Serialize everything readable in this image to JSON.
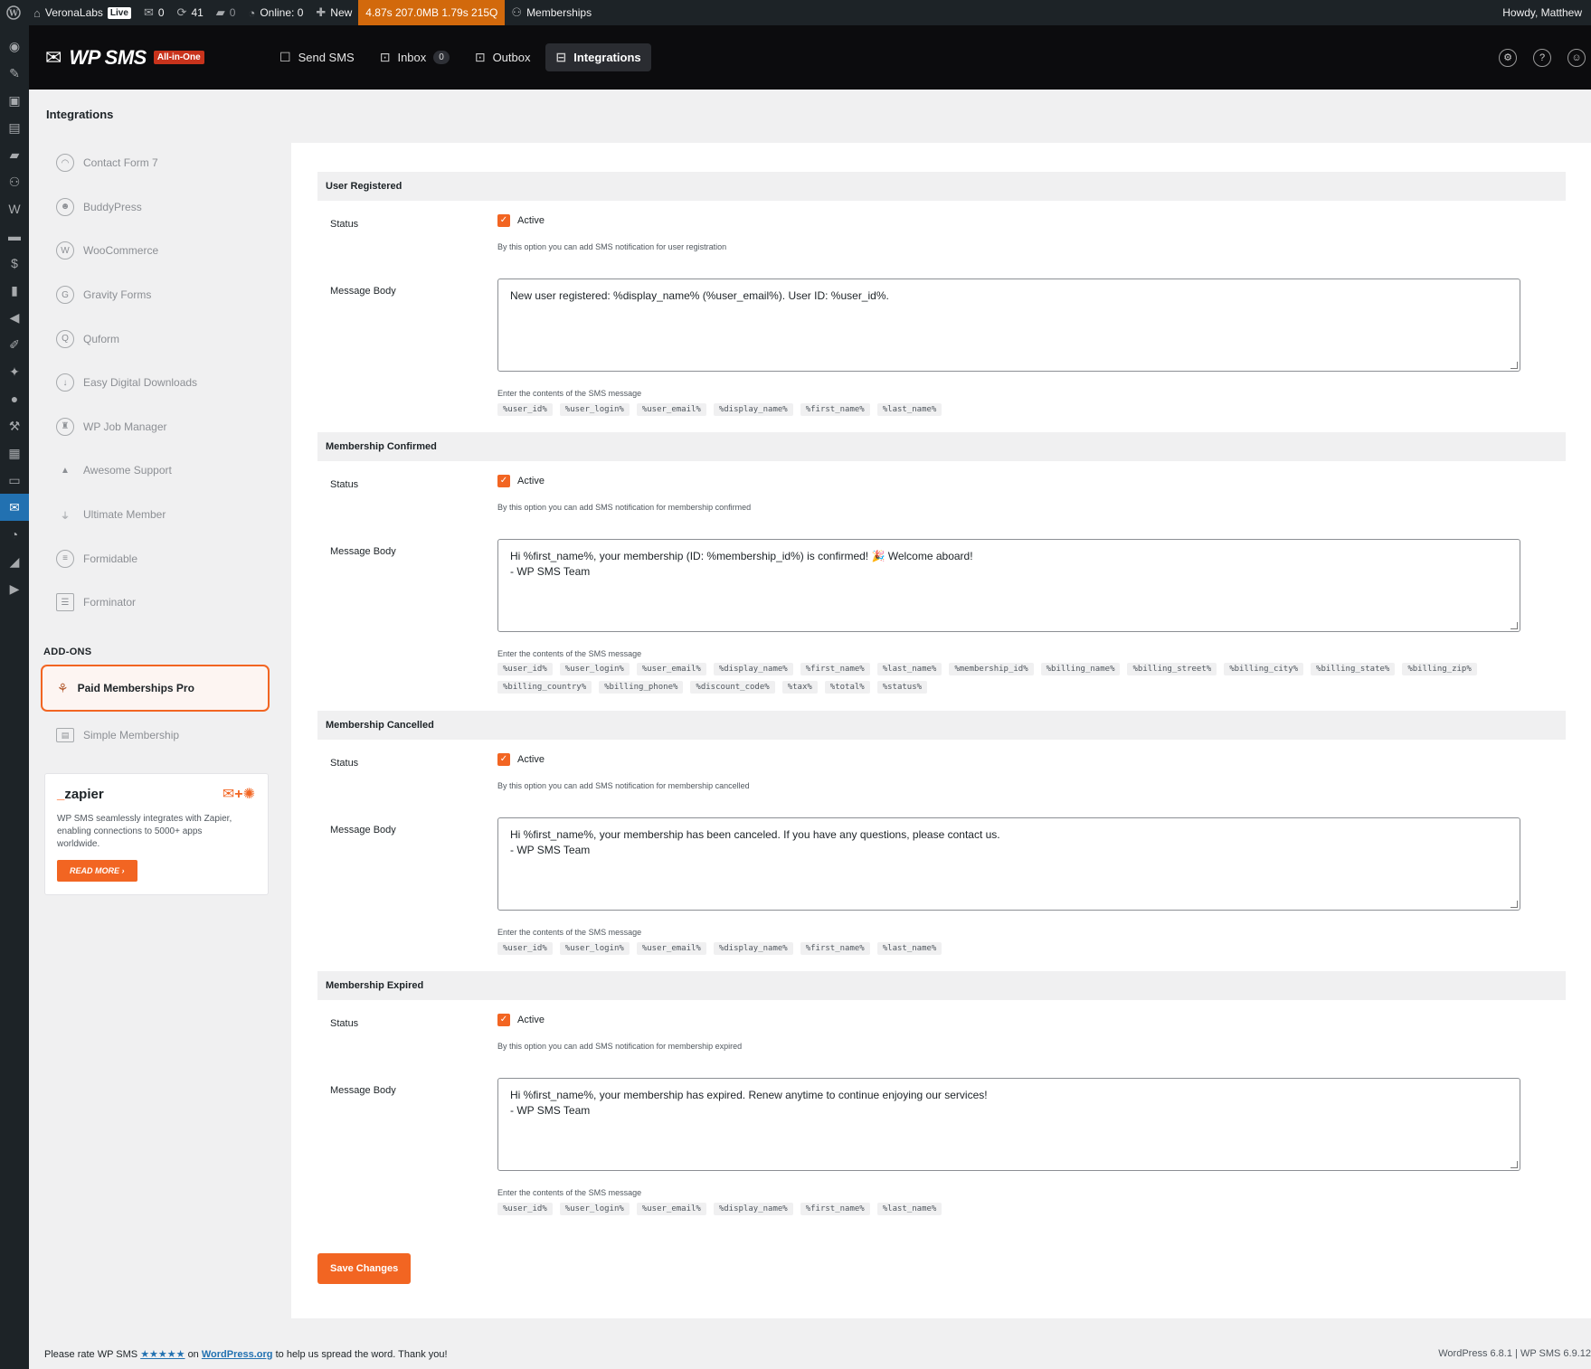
{
  "adminbar": {
    "site": "VeronaLabs",
    "live": "Live",
    "mail_count": "0",
    "updates": "41",
    "comments": "0",
    "online": "Online: 0",
    "new": "New",
    "perf": "4.87s  207.0MB  1.79s  215Q",
    "memberships": "Memberships",
    "howdy": "Howdy, Matthew"
  },
  "header": {
    "logo_text": "WP SMS",
    "badge": "All-in-One",
    "nav": [
      {
        "label": "Send SMS"
      },
      {
        "label": "Inbox",
        "count": "0"
      },
      {
        "label": "Outbox"
      },
      {
        "label": "Integrations"
      }
    ]
  },
  "sidebar": {
    "title": "Integrations",
    "items": [
      {
        "label": "Contact Form 7"
      },
      {
        "label": "BuddyPress"
      },
      {
        "label": "WooCommerce"
      },
      {
        "label": "Gravity Forms"
      },
      {
        "label": "Quform"
      },
      {
        "label": "Easy Digital Downloads"
      },
      {
        "label": "WP Job Manager"
      },
      {
        "label": "Awesome Support"
      },
      {
        "label": "Ultimate Member"
      },
      {
        "label": "Formidable"
      },
      {
        "label": "Forminator"
      }
    ],
    "addons_heading": "ADD-ONS",
    "active_addon": "Paid Memberships Pro",
    "other_addon": "Simple Membership",
    "zapier": {
      "logo": "zapier",
      "description": "WP SMS seamlessly integrates with Zapier, enabling connections to 5000+ apps worldwide.",
      "button": "READ MORE"
    }
  },
  "labels": {
    "status": "Status",
    "active": "Active",
    "message_body": "Message Body",
    "contents_hint": "Enter the contents of the SMS message"
  },
  "sections": [
    {
      "title": "User Registered",
      "status_hint": "By this option you can add SMS notification for user registration",
      "message": "New user registered: %display_name% (%user_email%). User ID: %user_id%.",
      "tags": [
        "%user_id%",
        "%user_login%",
        "%user_email%",
        "%display_name%",
        "%first_name%",
        "%last_name%"
      ]
    },
    {
      "title": "Membership Confirmed",
      "status_hint": "By this option you can add SMS notification for membership confirmed",
      "message": "Hi %first_name%, your membership (ID: %membership_id%) is confirmed! 🎉 Welcome aboard!\n- WP SMS Team",
      "tags": [
        "%user_id%",
        "%user_login%",
        "%user_email%",
        "%display_name%",
        "%first_name%",
        "%last_name%",
        "%membership_id%",
        "%billing_name%",
        "%billing_street%",
        "%billing_city%",
        "%billing_state%",
        "%billing_zip%",
        "%billing_country%",
        "%billing_phone%",
        "%discount_code%",
        "%tax%",
        "%total%",
        "%status%"
      ]
    },
    {
      "title": "Membership Cancelled",
      "status_hint": "By this option you can add SMS notification for membership cancelled",
      "message": "Hi %first_name%, your membership has been canceled. If you have any questions, please contact us.\n- WP SMS Team",
      "tags": [
        "%user_id%",
        "%user_login%",
        "%user_email%",
        "%display_name%",
        "%first_name%",
        "%last_name%"
      ]
    },
    {
      "title": "Membership Expired",
      "status_hint": "By this option you can add SMS notification for membership expired",
      "message": "Hi %first_name%, your membership has expired. Renew anytime to continue enjoying our services!\n- WP SMS Team",
      "tags": [
        "%user_id%",
        "%user_login%",
        "%user_email%",
        "%display_name%",
        "%first_name%",
        "%last_name%"
      ]
    }
  ],
  "save_label": "Save Changes",
  "footer": {
    "rate_prefix": "Please rate WP SMS",
    "stars": "★★★★★",
    "on": "on",
    "wporg": "WordPress.org",
    "rate_suffix": "to help us spread the word. Thank you!",
    "version": "WordPress 6.8.1 | WP SMS 6.9.12"
  }
}
